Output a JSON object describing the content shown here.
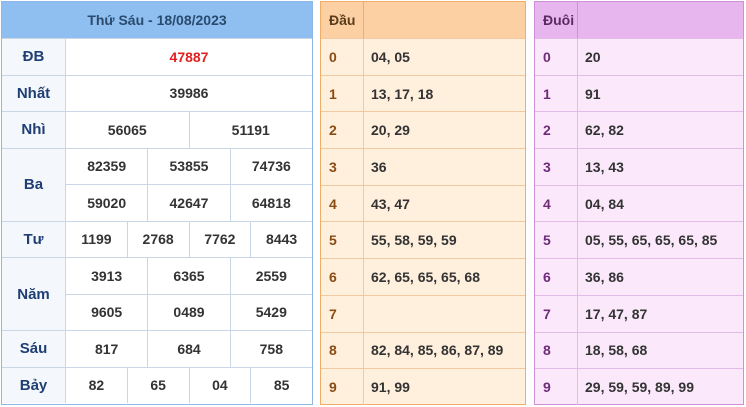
{
  "results": {
    "title": "Thứ Sáu - 18/08/2023",
    "prizes": [
      {
        "label": "ĐB",
        "lines": [
          [
            "47887"
          ]
        ],
        "special": true
      },
      {
        "label": "Nhất",
        "lines": [
          [
            "39986"
          ]
        ]
      },
      {
        "label": "Nhì",
        "lines": [
          [
            "56065",
            "51191"
          ]
        ]
      },
      {
        "label": "Ba",
        "lines": [
          [
            "82359",
            "53855",
            "74736"
          ],
          [
            "59020",
            "42647",
            "64818"
          ]
        ]
      },
      {
        "label": "Tư",
        "lines": [
          [
            "1199",
            "2768",
            "7762",
            "8443"
          ]
        ]
      },
      {
        "label": "Năm",
        "lines": [
          [
            "3913",
            "6365",
            "2559"
          ],
          [
            "9605",
            "0489",
            "5429"
          ]
        ]
      },
      {
        "label": "Sáu",
        "lines": [
          [
            "817",
            "684",
            "758"
          ]
        ]
      },
      {
        "label": "Bảy",
        "lines": [
          [
            "82",
            "65",
            "04",
            "85"
          ]
        ]
      }
    ]
  },
  "dau": {
    "header": "Đầu",
    "rows": [
      {
        "digit": "0",
        "values": "04, 05"
      },
      {
        "digit": "1",
        "values": "13, 17, 18"
      },
      {
        "digit": "2",
        "values": "20, 29"
      },
      {
        "digit": "3",
        "values": "36"
      },
      {
        "digit": "4",
        "values": "43, 47"
      },
      {
        "digit": "5",
        "values": "55, 58, 59, 59"
      },
      {
        "digit": "6",
        "values": "62, 65, 65, 65, 68"
      },
      {
        "digit": "7",
        "values": ""
      },
      {
        "digit": "8",
        "values": "82, 84, 85, 86, 87, 89"
      },
      {
        "digit": "9",
        "values": "91, 99"
      }
    ]
  },
  "duoi": {
    "header": "Đuôi",
    "rows": [
      {
        "digit": "0",
        "values": "20"
      },
      {
        "digit": "1",
        "values": "91"
      },
      {
        "digit": "2",
        "values": "62, 82"
      },
      {
        "digit": "3",
        "values": "13, 43"
      },
      {
        "digit": "4",
        "values": "04, 84"
      },
      {
        "digit": "5",
        "values": "05, 55, 65, 65, 65, 85"
      },
      {
        "digit": "6",
        "values": "36, 86"
      },
      {
        "digit": "7",
        "values": "17, 47, 87"
      },
      {
        "digit": "8",
        "values": "18, 58, 68"
      },
      {
        "digit": "9",
        "values": "29, 59, 59, 89, 99"
      }
    ]
  },
  "colors": {
    "special_prize": "#e11f1f",
    "results_header": "#8fbff0",
    "dau_header": "#fcd0a2",
    "duoi_header": "#e8b6ee"
  }
}
